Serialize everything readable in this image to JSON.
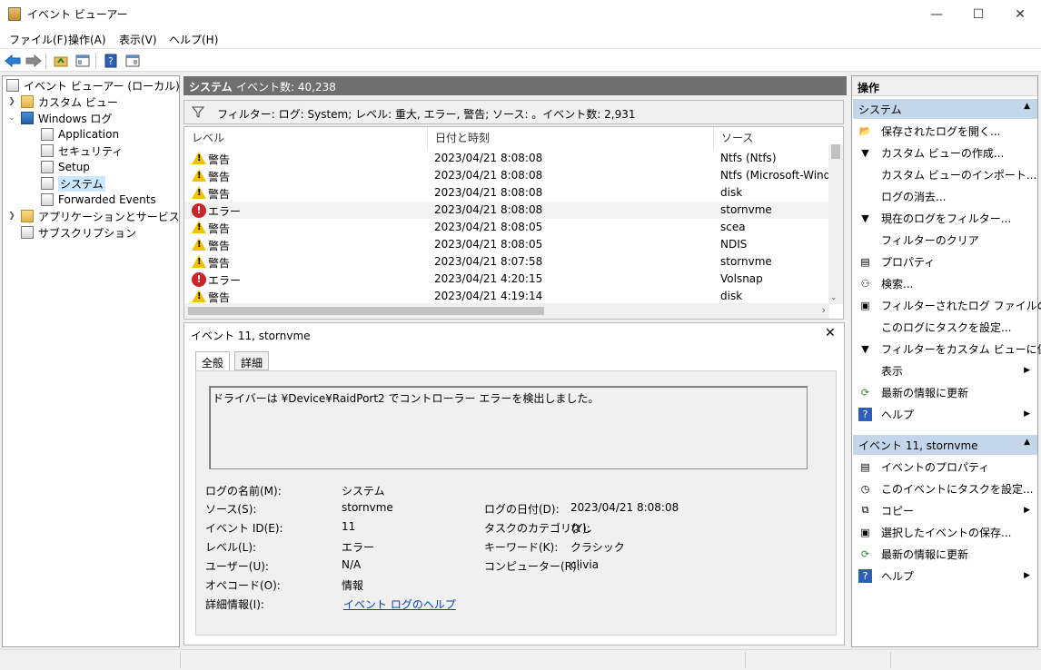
{
  "window": {
    "title": "イベント ビューアー",
    "min": "—",
    "max": "☐",
    "close": "✕"
  },
  "menu": [
    "ファイル(F)",
    "操作(A)",
    "表示(V)",
    "ヘルプ(H)"
  ],
  "tree": {
    "root": "イベント ビューアー (ローカル)",
    "custom_views": "カスタム ビュー",
    "windows_logs": "Windows ログ",
    "logs": [
      "Application",
      "セキュリティ",
      "Setup",
      "システム",
      "Forwarded Events"
    ],
    "app_services": "アプリケーションとサービス ログ",
    "subscriptions": "サブスクリプション"
  },
  "center": {
    "title": "システム",
    "count": "イベント数: 40,238",
    "filter": "フィルター: ログ: System; レベル: 重大, エラー, 警告; ソース: 。イベント数: 2,931",
    "columns": [
      "レベル",
      "日付と時刻",
      "ソース"
    ],
    "rows": [
      {
        "level": "警告",
        "type": "warn",
        "date": "2023/04/21 8:08:08",
        "source": "Ntfs (Ntfs)"
      },
      {
        "level": "警告",
        "type": "warn",
        "date": "2023/04/21 8:08:08",
        "source": "Ntfs (Microsoft-Windo"
      },
      {
        "level": "警告",
        "type": "warn",
        "date": "2023/04/21 8:08:08",
        "source": "disk"
      },
      {
        "level": "エラー",
        "type": "error",
        "date": "2023/04/21 8:08:08",
        "source": "stornvme"
      },
      {
        "level": "警告",
        "type": "warn",
        "date": "2023/04/21 8:08:05",
        "source": "scea"
      },
      {
        "level": "警告",
        "type": "warn",
        "date": "2023/04/21 8:08:05",
        "source": "NDIS"
      },
      {
        "level": "警告",
        "type": "warn",
        "date": "2023/04/21 8:07:58",
        "source": "stornvme"
      },
      {
        "level": "エラー",
        "type": "error",
        "date": "2023/04/21 4:20:15",
        "source": "Volsnap"
      },
      {
        "level": "警告",
        "type": "warn",
        "date": "2023/04/21 4:19:14",
        "source": "disk"
      }
    ]
  },
  "detail": {
    "title": "イベント 11, stornvme",
    "tabs": [
      "全般",
      "詳細"
    ],
    "description": "ドライバーは ¥Device¥RaidPort2 でコントローラー エラーを検出しました。",
    "labels": {
      "log_name": "ログの名前(M):",
      "source": "ソース(S):",
      "event_id": "イベント ID(E):",
      "level": "レベル(L):",
      "user": "ユーザー(U):",
      "opcode": "オペコード(O):",
      "more_info": "詳細情報(I):",
      "logged": "ログの日付(D):",
      "task_category": "タスクのカテゴリ(Y):",
      "keywords": "キーワード(K):",
      "computer": "コンピューター(R):"
    },
    "values": {
      "log_name": "システム",
      "source": "stornvme",
      "event_id": "11",
      "level": "エラー",
      "user": "N/A",
      "opcode": "情報",
      "more_info_link": "イベント ログのヘルプ",
      "logged": "2023/04/21 8:08:08",
      "task_category": "なし",
      "keywords": "クラシック",
      "computer": "clivia"
    }
  },
  "actions": {
    "header": "操作",
    "section1": "システム",
    "items1": [
      "保存されたログを開く...",
      "カスタム ビューの作成...",
      "カスタム ビューのインポート...",
      "ログの消去...",
      "現在のログをフィルター...",
      "フィルターのクリア",
      "プロパティ",
      "検索...",
      "フィルターされたログ ファイルの...",
      "このログにタスクを設定...",
      "フィルターをカスタム ビューに保...",
      "表示",
      "最新の情報に更新",
      "ヘルプ"
    ],
    "section2": "イベント 11, stornvme",
    "items2": [
      "イベントのプロパティ",
      "このイベントにタスクを設定...",
      "コピー",
      "選択したイベントの保存...",
      "最新の情報に更新",
      "ヘルプ"
    ]
  }
}
